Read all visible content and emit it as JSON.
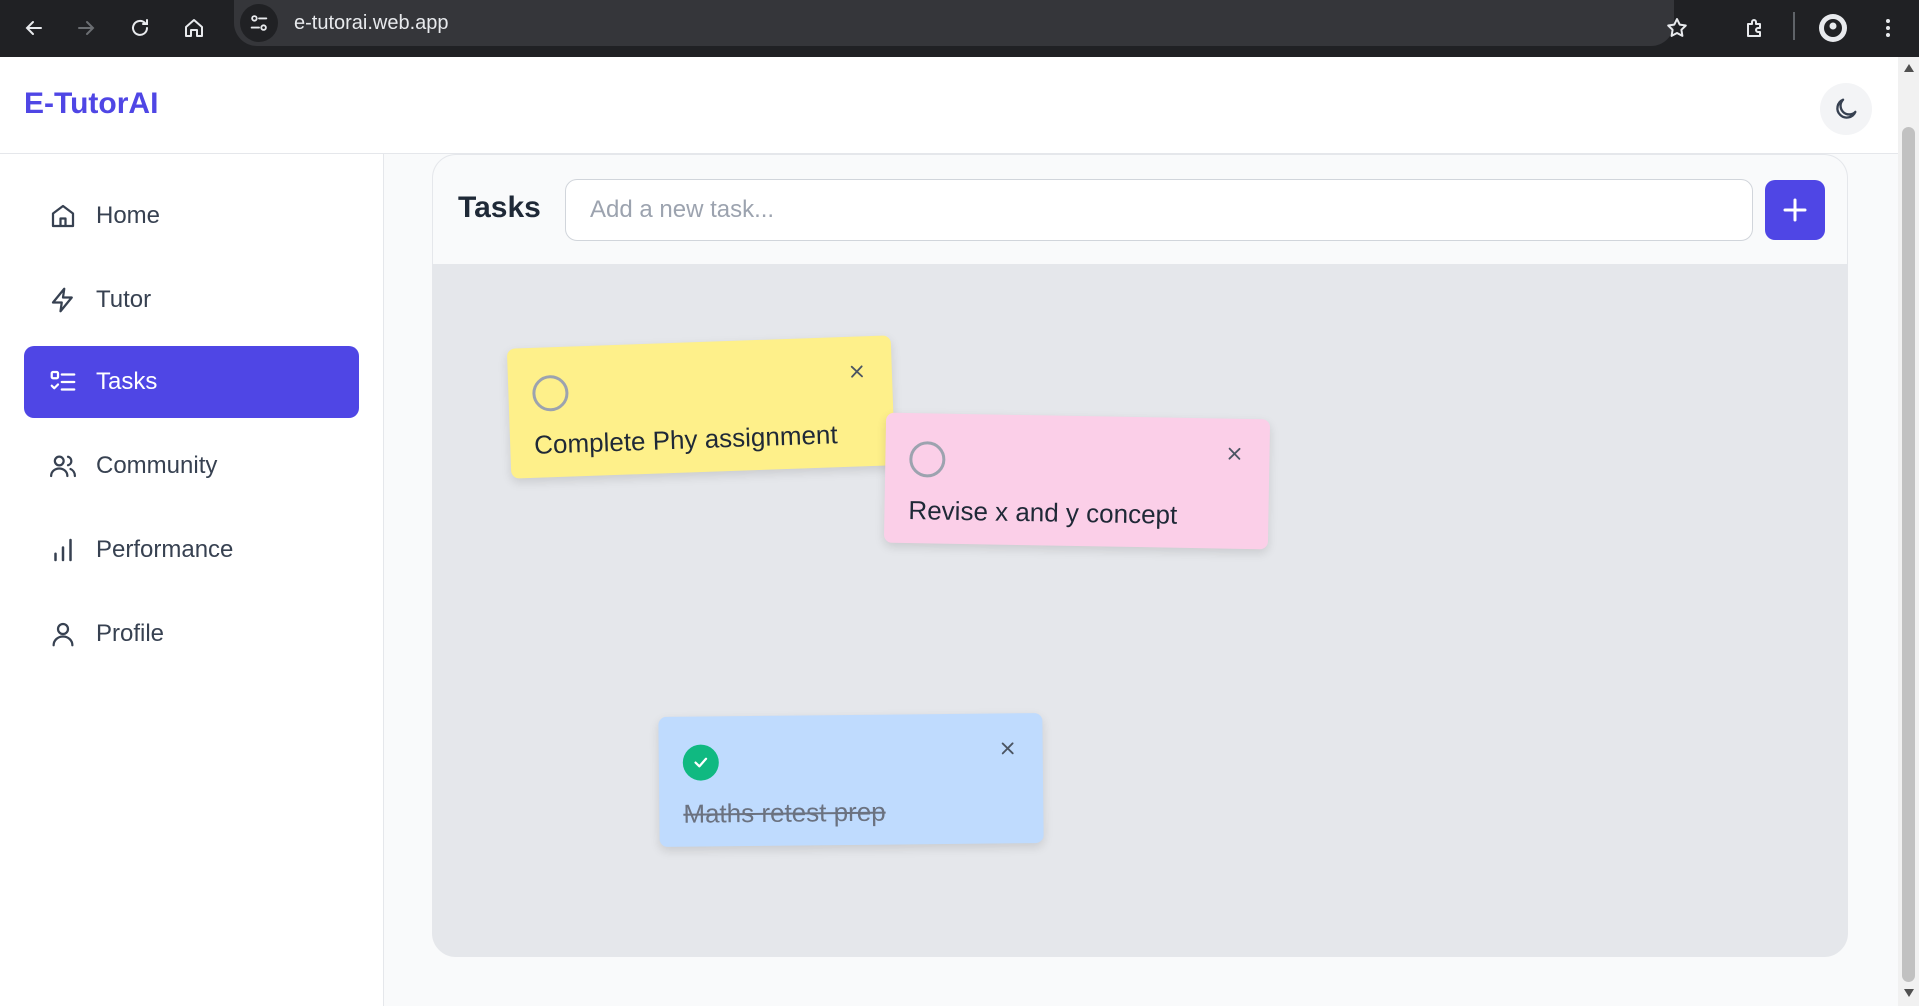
{
  "browser": {
    "url": "e-tutorai.web.app"
  },
  "app": {
    "brand": "E-TutorAI",
    "brand_color": "#4f46e5"
  },
  "sidebar": {
    "items": [
      {
        "label": "Home",
        "icon": "home-icon",
        "active": false
      },
      {
        "label": "Tutor",
        "icon": "lightning-icon",
        "active": false
      },
      {
        "label": "Tasks",
        "icon": "list-check-icon",
        "active": true
      },
      {
        "label": "Community",
        "icon": "users-icon",
        "active": false
      },
      {
        "label": "Performance",
        "icon": "bar-chart-icon",
        "active": false
      },
      {
        "label": "Profile",
        "icon": "user-icon",
        "active": false
      }
    ]
  },
  "tasks": {
    "title": "Tasks",
    "input_placeholder": "Add a new task...",
    "input_value": "",
    "notes": [
      {
        "text": "Complete Phy assignment",
        "color": "#fef08a",
        "done": false
      },
      {
        "text": "Revise x and y concept",
        "color": "#fbcfe8",
        "done": false
      },
      {
        "text": "Maths retest prep",
        "color": "#bfdbfe",
        "done": true
      }
    ]
  }
}
